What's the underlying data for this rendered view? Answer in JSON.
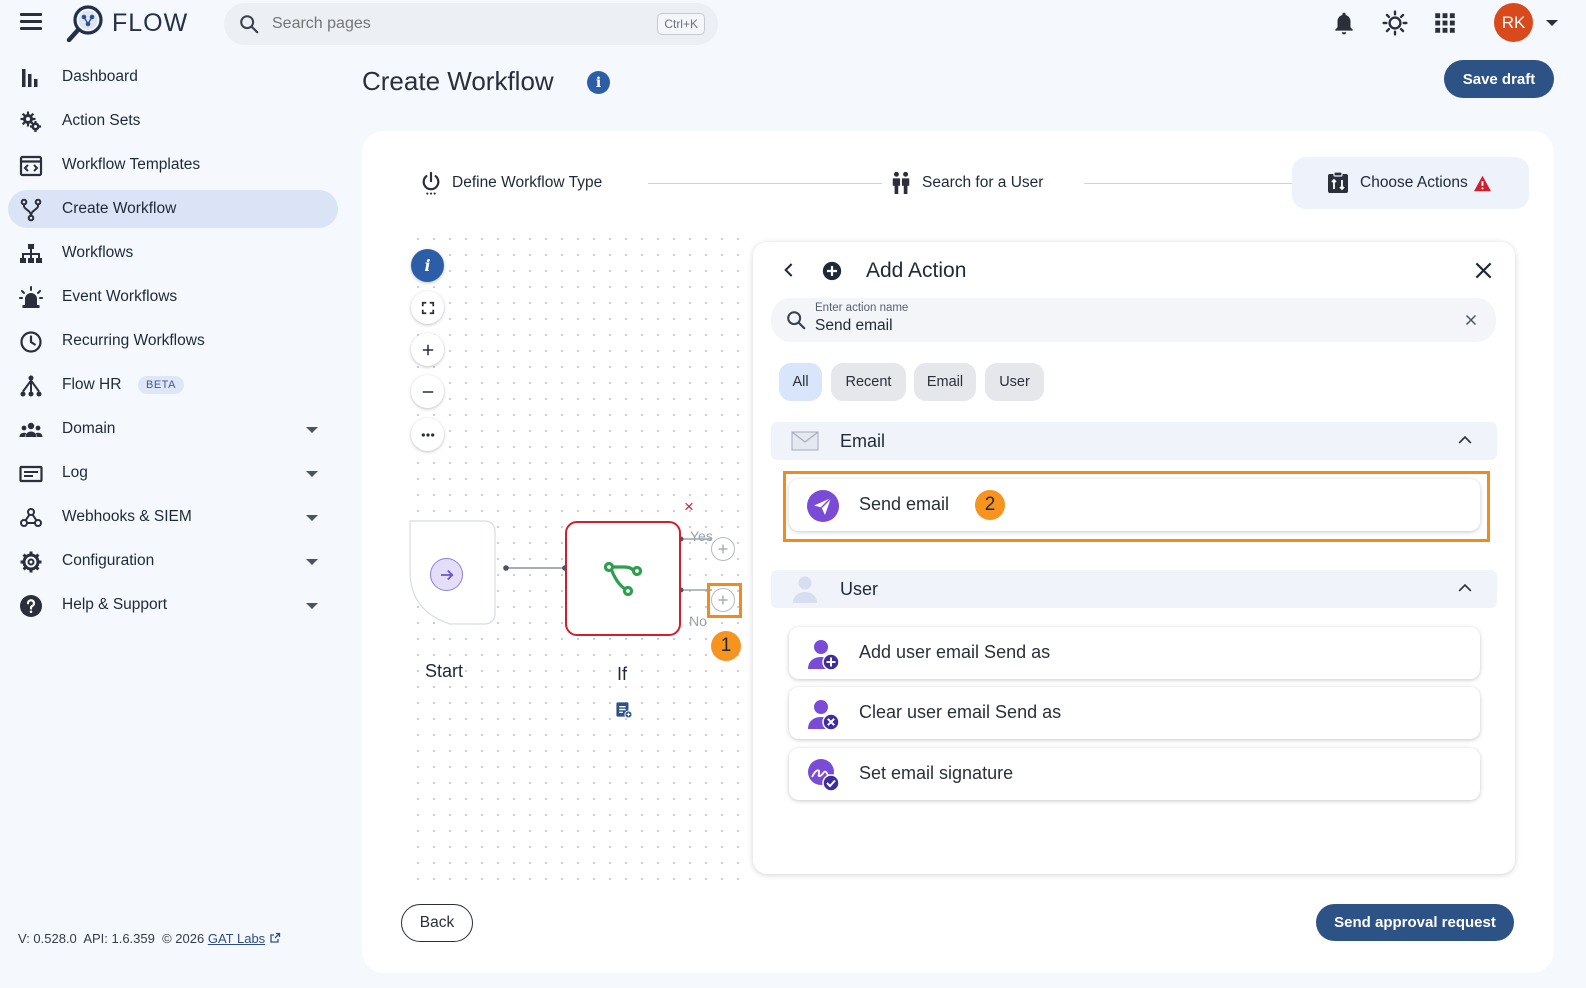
{
  "header": {
    "brand": "FLOW",
    "search_placeholder": "Search pages",
    "search_shortcut": "Ctrl+K",
    "avatar_initials": "RK"
  },
  "sidebar": {
    "items": [
      {
        "label": "Dashboard",
        "icon": "bar-chart-icon"
      },
      {
        "label": "Action Sets",
        "icon": "gears-icon"
      },
      {
        "label": "Workflow Templates",
        "icon": "template-icon"
      },
      {
        "label": "Create Workflow",
        "icon": "fork-icon",
        "active": true
      },
      {
        "label": "Workflows",
        "icon": "sitemap-icon"
      },
      {
        "label": "Event Workflows",
        "icon": "alarm-light-icon"
      },
      {
        "label": "Recurring Workflows",
        "icon": "clock-icon"
      },
      {
        "label": "Flow HR",
        "icon": "hr-tree-icon",
        "badge": "BETA"
      },
      {
        "label": "Domain",
        "icon": "users-group-icon",
        "expandable": true
      },
      {
        "label": "Log",
        "icon": "log-card-icon",
        "expandable": true
      },
      {
        "label": "Webhooks & SIEM",
        "icon": "webhook-icon",
        "expandable": true
      },
      {
        "label": "Configuration",
        "icon": "gear-icon",
        "expandable": true
      },
      {
        "label": "Help & Support",
        "icon": "help-icon",
        "expandable": true
      }
    ],
    "footer": {
      "version": "V: 0.528.0",
      "api": "API: 1.6.359",
      "copyright": "© 2026",
      "link": "GAT Labs"
    }
  },
  "main": {
    "title": "Create Workflow",
    "save_draft": "Save draft",
    "steps": [
      {
        "label": "Define Workflow Type"
      },
      {
        "label": "Search for a User"
      },
      {
        "label": "Choose Actions"
      }
    ],
    "canvas": {
      "info_label": "i",
      "start_label": "Start",
      "if_label": "If",
      "yes_label": "Yes",
      "no_label": "No",
      "delete_symbol": "×"
    },
    "back": "Back",
    "send_approval": "Send approval request"
  },
  "panel": {
    "title": "Add Action",
    "search_label": "Enter action name",
    "search_value": "Send email",
    "chips": [
      "All",
      "Recent",
      "Email",
      "User"
    ],
    "sections": [
      {
        "label": "Email",
        "actions": [
          {
            "label": "Send email"
          }
        ]
      },
      {
        "label": "User",
        "actions": [
          {
            "label": "Add user email Send as"
          },
          {
            "label": "Clear user email Send as"
          },
          {
            "label": "Set email signature"
          }
        ]
      }
    ]
  },
  "annotations": {
    "badge1": "1",
    "badge2": "2",
    "highlight_color": "#f28b1c"
  },
  "colors": {
    "primary": "#2d5286",
    "danger": "#d01f2e",
    "accent_purple": "#7a4bd6",
    "branch_green": "#2e9e4f",
    "sidebar_active": "#dbe4f6"
  }
}
